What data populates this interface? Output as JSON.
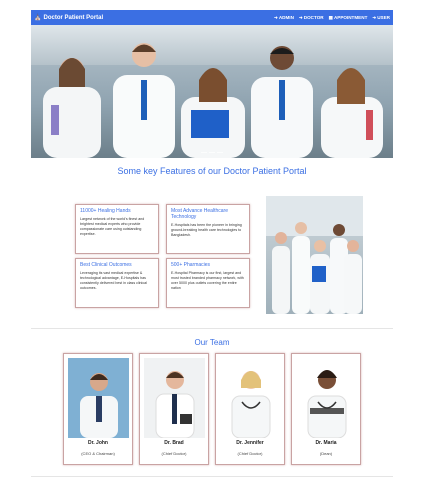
{
  "navbar": {
    "brand": "Doctor Patient Portal",
    "links": [
      {
        "label": "ADMIN",
        "icon": "sign-in-icon"
      },
      {
        "label": "DOCTOR",
        "icon": "sign-in-icon"
      },
      {
        "label": "APPOINTMENT",
        "icon": "calendar-icon"
      },
      {
        "label": "USER",
        "icon": "sign-in-icon"
      }
    ]
  },
  "features": {
    "title": "Some key Features of our Doctor Patient Portal",
    "cards": [
      {
        "title": "11000+ Healing Hands",
        "desc": "Largest network of the world's finest and brightest medical experts who provide compassionate care using outstanding expertise."
      },
      {
        "title": "Most Advance Healthcare Technology",
        "desc": "E-Hospitals has been the pioneer in bringing ground-breaking health care technologies to Bangladesh."
      },
      {
        "title": "Best Clinical Outcomes",
        "desc": "Leveraging its vast medical expertise & technological advantage, E-Hospitals has consistently delivered best in class clinical outcomes."
      },
      {
        "title": "500+ Pharmacies",
        "desc": "E-Hospital Pharmacy is our first, largest and most trusted branded pharmacy network, with over 5000 plus outlets covering the entire nation"
      }
    ]
  },
  "team": {
    "title": "Our Team",
    "members": [
      {
        "name": "Dr. John",
        "role": "(CEO & Chairman)"
      },
      {
        "name": "Dr. Brad",
        "role": "(Chief Doctor)"
      },
      {
        "name": "Dr. Jennifer",
        "role": "(Chief Doctor)"
      },
      {
        "name": "Dr. Maria",
        "role": "(Dean)"
      }
    ]
  },
  "colors": {
    "accent": "#3b6fe3",
    "card_border": "#c9a3a3"
  }
}
